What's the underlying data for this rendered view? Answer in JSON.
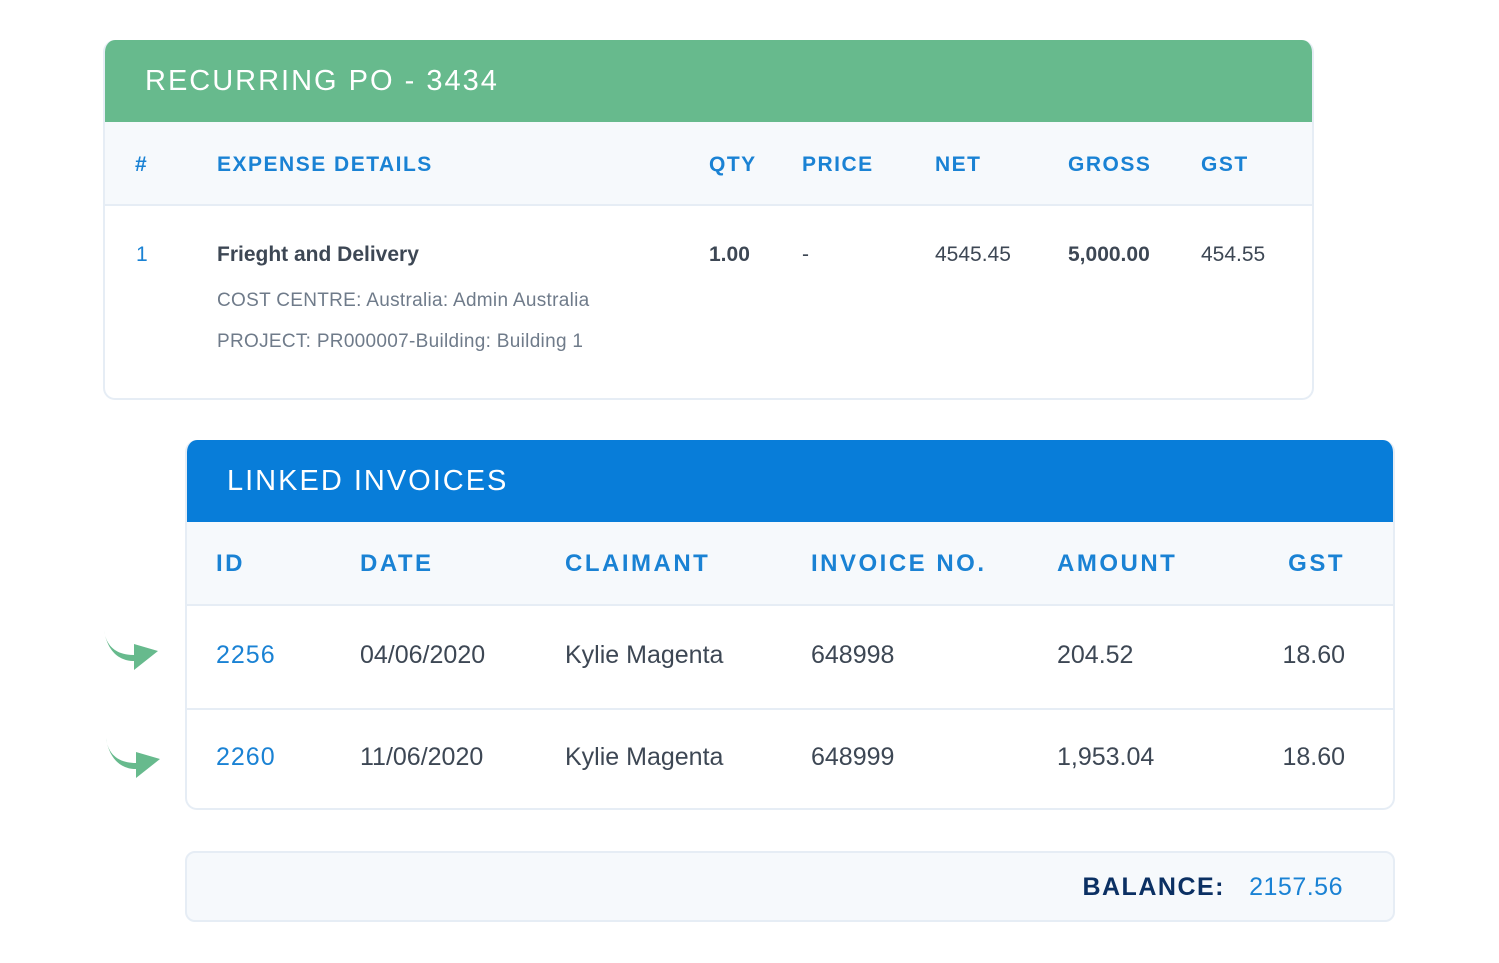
{
  "po": {
    "title": "RECURRING PO - 3434",
    "header_color": "#67ba8d",
    "columns": {
      "num": "#",
      "details": "EXPENSE DETAILS",
      "qty": "QTY",
      "price": "PRICE",
      "net": "NET",
      "gross": "GROSS",
      "gst": "GST"
    },
    "items": [
      {
        "num": "1",
        "description": "Frieght and Delivery",
        "cost_centre": "COST CENTRE: Australia: Admin Australia",
        "project": "PROJECT: PR000007-Building: Building 1",
        "qty": "1.00",
        "price": "-",
        "net": "4545.45",
        "gross": "5,000.00",
        "gst": "454.55"
      }
    ]
  },
  "invoices": {
    "title": "LINKED INVOICES",
    "header_color": "#087dd9",
    "columns": {
      "id": "ID",
      "date": "DATE",
      "claimant": "CLAIMANT",
      "invoice_no": "INVOICE NO.",
      "amount": "AMOUNT",
      "gst": "GST"
    },
    "rows": [
      {
        "id": "2256",
        "date": "04/06/2020",
        "claimant": "Kylie Magenta",
        "invoice_no": "648998",
        "amount": "204.52",
        "gst": "18.60",
        "icon": "curved-arrow-right-icon"
      },
      {
        "id": "2260",
        "date": "11/06/2020",
        "claimant": "Kylie Magenta",
        "invoice_no": "648999",
        "amount": "1,953.04",
        "gst": "18.60",
        "icon": "curved-arrow-right-icon"
      }
    ]
  },
  "balance": {
    "label": "BALANCE:",
    "value": "2157.56"
  },
  "colors": {
    "accent_blue": "#1a82d4",
    "accent_green": "#67ba8d",
    "navy": "#0b3063"
  }
}
